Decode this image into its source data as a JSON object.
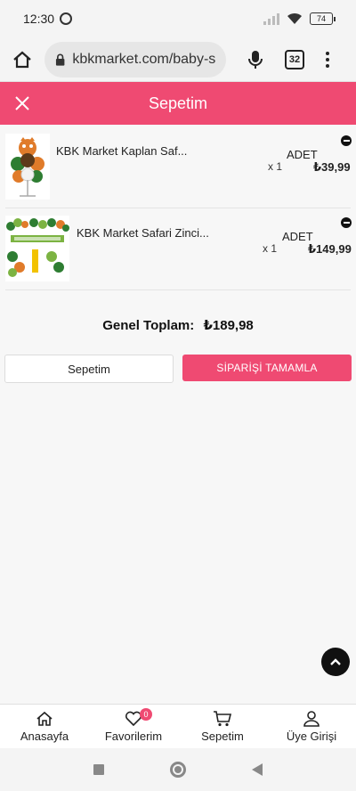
{
  "status_bar": {
    "time": "12:30",
    "battery": "74"
  },
  "browser": {
    "url": "kbkmarket.com/baby-sh",
    "tab_count": "32"
  },
  "header": {
    "title": "Sepetim"
  },
  "cart": {
    "items": [
      {
        "name": "KBK Market Kaplan Saf...",
        "unit": "ADET",
        "qty": "x 1",
        "price": "₺39,99"
      },
      {
        "name": "KBK Market Safari Zinci...",
        "unit": "ADET",
        "qty": "x 1",
        "price": "₺149,99"
      }
    ],
    "total_label": "Genel Toplam:",
    "total_value": "₺189,98",
    "cart_button": "Sepetim",
    "checkout_button": "SİPARİŞİ TAMAMLA"
  },
  "bottom_nav": {
    "home": "Anasayfa",
    "favorites": "Favorilerim",
    "favorites_badge": "0",
    "cart": "Sepetim",
    "login": "Üye Girişi"
  },
  "colors": {
    "accent": "#ef4a72"
  }
}
